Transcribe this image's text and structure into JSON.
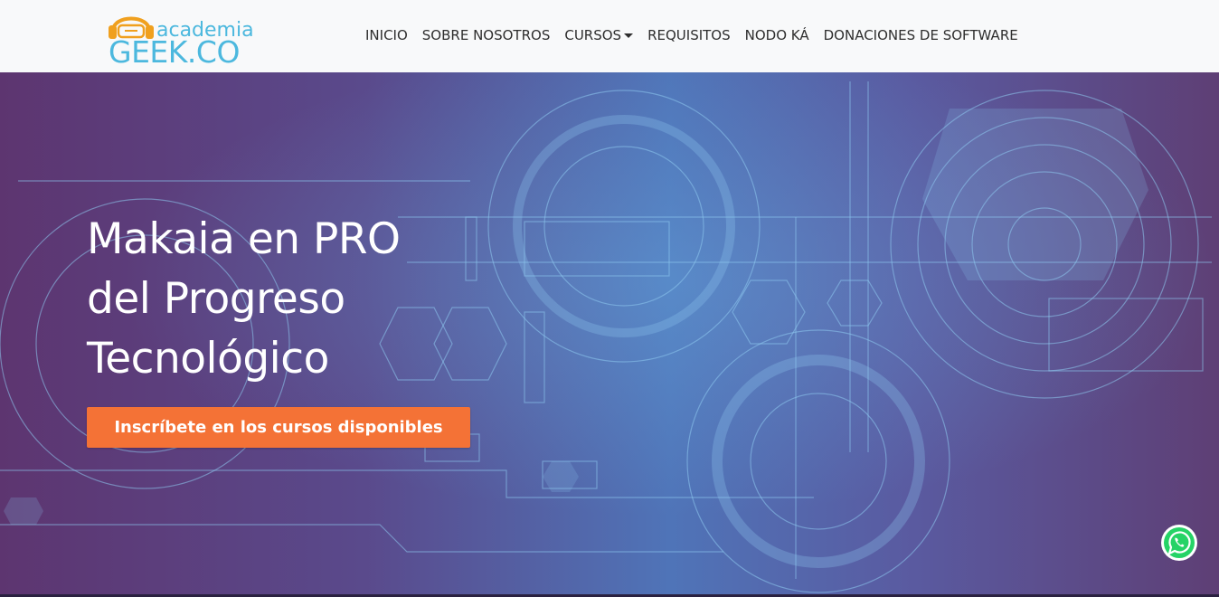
{
  "logo": {
    "small_text": "academia",
    "big_text": "GEEK.CO",
    "brand_color": "#4cb8de",
    "headphones_color": "#f0a01e"
  },
  "nav": {
    "items": [
      {
        "label": "INICIO"
      },
      {
        "label": "SOBRE NOSOTROS"
      },
      {
        "label": "CURSOS",
        "has_dropdown": true
      },
      {
        "label": "REQUISITOS"
      },
      {
        "label": "NODO KÁ"
      },
      {
        "label": "DONACIONES DE SOFTWARE"
      }
    ]
  },
  "hero": {
    "title_lines": [
      "Makaia en PRO",
      "del Progreso",
      "Tecnológico"
    ],
    "cta_label": "Inscríbete en los cursos disponibles",
    "cta_color": "#f47236"
  },
  "whatsapp": {
    "icon": "whatsapp-icon",
    "color": "#25d366"
  }
}
